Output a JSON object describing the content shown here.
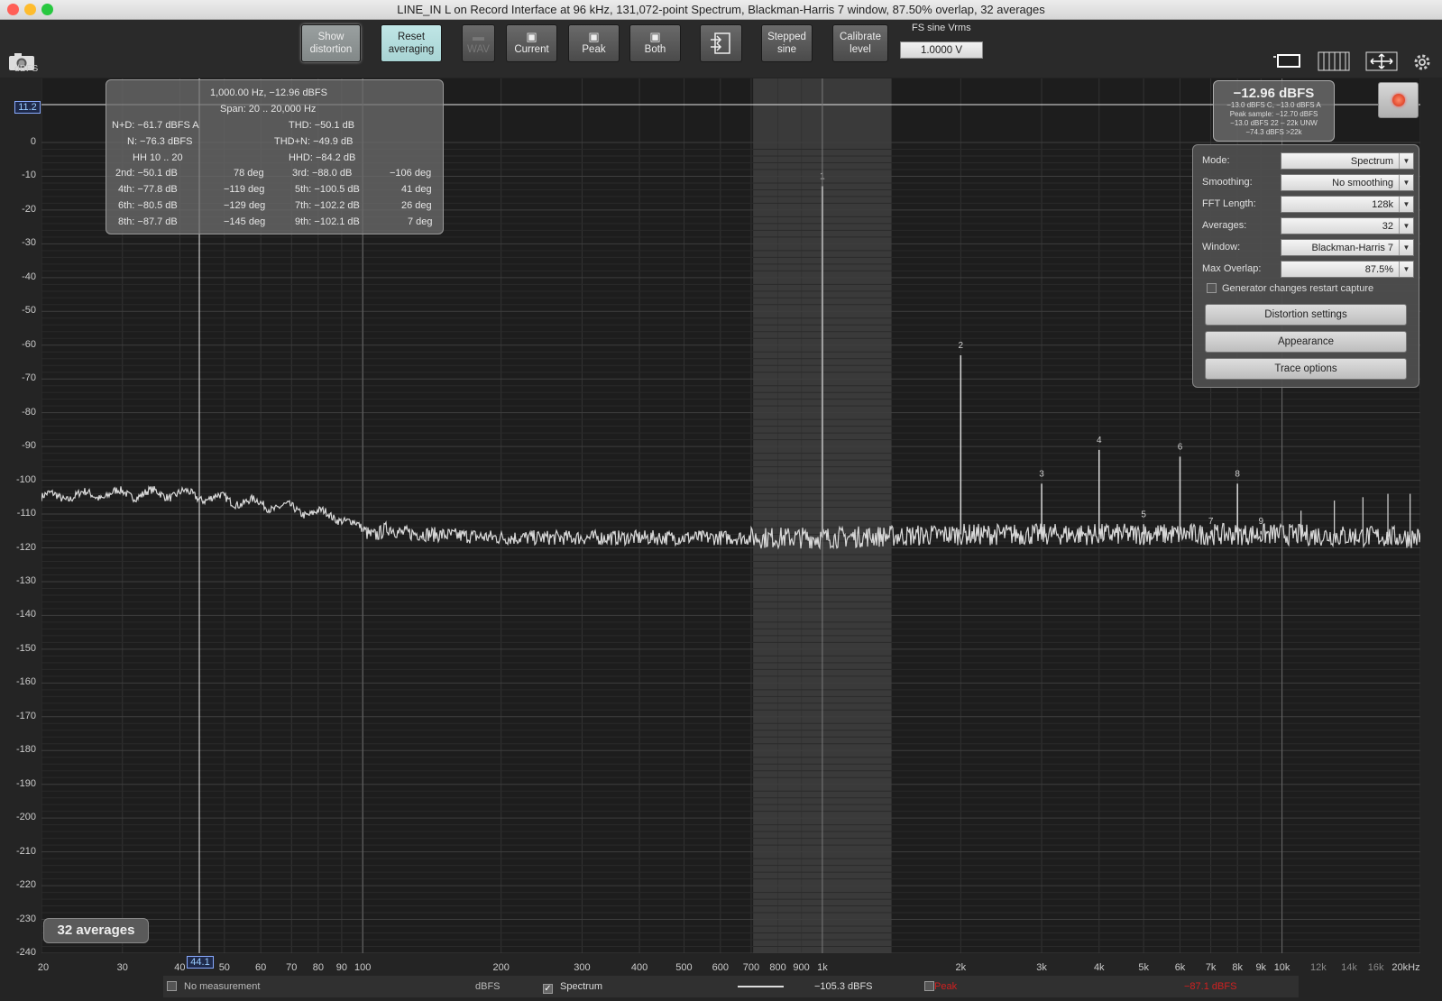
{
  "window": {
    "title": "LINE_IN L on Record Interface at 96 kHz, 131,072-point Spectrum, Blackman-Harris 7 window, 87.50% overlap, 32 averages"
  },
  "toolbar": {
    "show_distortion": [
      "Show",
      "distortion"
    ],
    "reset_averaging": [
      "Reset",
      "averaging"
    ],
    "wav": "WAV",
    "current": "Current",
    "peak": "Peak",
    "both": "Both",
    "stepped_sine": [
      "Stepped",
      "sine"
    ],
    "calibrate_level": [
      "Calibrate",
      "level"
    ],
    "fs_label": "FS sine Vrms",
    "fs_value": "1.0000 V"
  },
  "axes": {
    "y_unit": "dBFS",
    "y_ticks": [
      "0",
      "-10",
      "-20",
      "-30",
      "-40",
      "-50",
      "-60",
      "-70",
      "-80",
      "-90",
      "-100",
      "-110",
      "-120",
      "-130",
      "-140",
      "-150",
      "-160",
      "-170",
      "-180",
      "-190",
      "-200",
      "-210",
      "-220",
      "-230",
      "-240"
    ],
    "x_ticks": [
      "20",
      "30",
      "40",
      "50",
      "60",
      "70",
      "80",
      "90",
      "100",
      "200",
      "300",
      "400",
      "500",
      "600",
      "700",
      "800",
      "900",
      "1k",
      "2k",
      "3k",
      "4k",
      "5k",
      "6k",
      "7k",
      "8k",
      "9k",
      "10k",
      "12k",
      "14k",
      "16k",
      "20kHz"
    ],
    "cursor_y": "11.2",
    "cursor_x": "44.1"
  },
  "distortion": {
    "header": "1,000.00 Hz, −12.96 dBFS",
    "span": "Span: 20 .. 20,000 Hz",
    "nd": "N+D: −61.7 dBFS A",
    "thd": "THD: −50.1 dB",
    "n": "N: −76.3 dBFS",
    "thdn": "THD+N: −49.9 dB",
    "hh": "HH 10 .. 20",
    "hhd": "HHD: −84.2 dB",
    "h2": "2nd: −50.1 dB",
    "h2d": "78 deg",
    "h3": "3rd: −88.0 dB",
    "h3d": "−106 deg",
    "h4": "4th: −77.8 dB",
    "h4d": "−119 deg",
    "h5": "5th: −100.5 dB",
    "h5d": "41 deg",
    "h6": "6th: −80.5 dB",
    "h6d": "−129 deg",
    "h7": "7th: −102.2 dB",
    "h7d": "26 deg",
    "h8": "8th: −87.7 dB",
    "h8d": "−145 deg",
    "h9": "9th: −102.1 dB",
    "h9d": "7 deg"
  },
  "level": {
    "main": "−12.96 dBFS",
    "l1": "−13.0 dBFS C, −13.0 dBFS A",
    "l2": "Peak sample: −12.70 dBFS",
    "l3": "−13.0 dBFS 22 – 22k UNW",
    "l4": "−74.3 dBFS >22k"
  },
  "controls": {
    "mode_label": "Mode:",
    "mode": "Spectrum",
    "smoothing_label": "Smoothing:",
    "smoothing": "No  smoothing",
    "fft_label": "FFT Length:",
    "fft": "128k",
    "averages_label": "Averages:",
    "averages": "32",
    "window_label": "Window:",
    "window": "Blackman-Harris 7",
    "overlap_label": "Max Overlap:",
    "overlap": "87.5%",
    "restart_label": "Generator changes restart capture",
    "distortion_settings": "Distortion settings",
    "appearance": "Appearance",
    "trace_options": "Trace options"
  },
  "avg_badge": "32 averages",
  "bottom": {
    "no_measurement": "No measurement",
    "dbfs": "dBFS",
    "spectrum": "Spectrum",
    "spectrum_value": "−105.3 dBFS",
    "peak": "Peak",
    "peak_value": "−87.1 dBFS"
  },
  "colors": {
    "trace": "#d8d8d8",
    "peak": "#d02020",
    "accent": "#8aaaff"
  },
  "chart_data": {
    "type": "line",
    "xscale": "log",
    "xlim": [
      20,
      20000
    ],
    "ylim": [
      -240,
      0
    ],
    "xlabel": "Hz",
    "ylabel": "dBFS",
    "noise_floor": {
      "x": [
        20,
        30,
        40,
        60,
        90,
        100,
        200,
        1000,
        2000,
        10000,
        20000
      ],
      "y": [
        -105,
        -104,
        -104,
        -107,
        -111,
        -115,
        -117,
        -117,
        -116,
        -116,
        -117
      ]
    },
    "harmonics": [
      {
        "label": "1",
        "freq": 1000,
        "level": -12.96
      },
      {
        "label": "2",
        "freq": 2000,
        "level": -63
      },
      {
        "label": "3",
        "freq": 3000,
        "level": -101
      },
      {
        "label": "4",
        "freq": 4000,
        "level": -91
      },
      {
        "label": "5",
        "freq": 5000,
        "level": -113
      },
      {
        "label": "6",
        "freq": 6000,
        "level": -93
      },
      {
        "label": "7",
        "freq": 7000,
        "level": -115
      },
      {
        "label": "8",
        "freq": 8000,
        "level": -101
      },
      {
        "label": "9",
        "freq": 9000,
        "level": -115
      }
    ],
    "extra_spurs": [
      {
        "freq": 10000,
        "level": -109
      },
      {
        "freq": 11000,
        "level": -109
      },
      {
        "freq": 13000,
        "level": -106
      },
      {
        "freq": 15000,
        "level": -105
      },
      {
        "freq": 17000,
        "level": -104
      },
      {
        "freq": 19000,
        "level": -104
      }
    ]
  }
}
